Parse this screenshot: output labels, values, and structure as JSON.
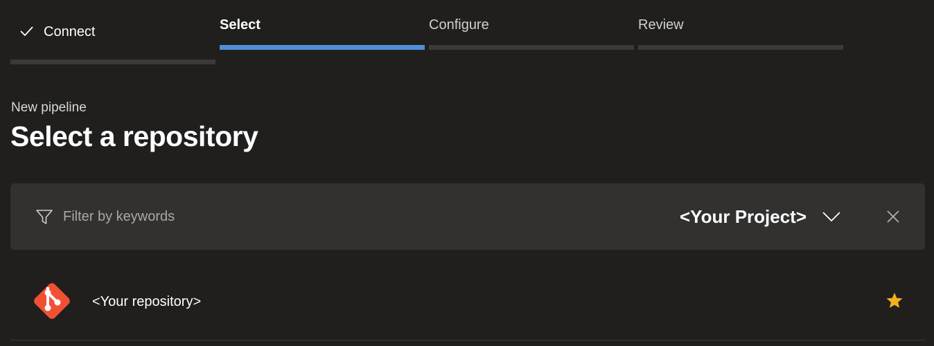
{
  "stepper": {
    "steps": [
      {
        "label": "Connect",
        "state": "completed"
      },
      {
        "label": "Select",
        "state": "active"
      },
      {
        "label": "Configure",
        "state": "upcoming"
      },
      {
        "label": "Review",
        "state": "upcoming"
      }
    ],
    "completed_icon": "checkmark-icon"
  },
  "header": {
    "subtitle": "New pipeline",
    "title": "Select a repository"
  },
  "filter": {
    "icon": "filter-icon",
    "placeholder": "Filter by keywords",
    "value": "",
    "project_label": "<Your Project>",
    "dropdown_icon": "chevron-down-icon",
    "clear_icon": "close-icon"
  },
  "repositories": [
    {
      "name": "<Your repository>",
      "icon": "git-icon",
      "favorite": true,
      "favorite_icon": "star-icon"
    }
  ],
  "colors": {
    "background": "#201f1e",
    "accent": "#4f8fd8",
    "inactive_bar": "#3b3a39",
    "filter_background": "#323130",
    "git_brand": "#f05133",
    "star": "#f2b01e"
  }
}
